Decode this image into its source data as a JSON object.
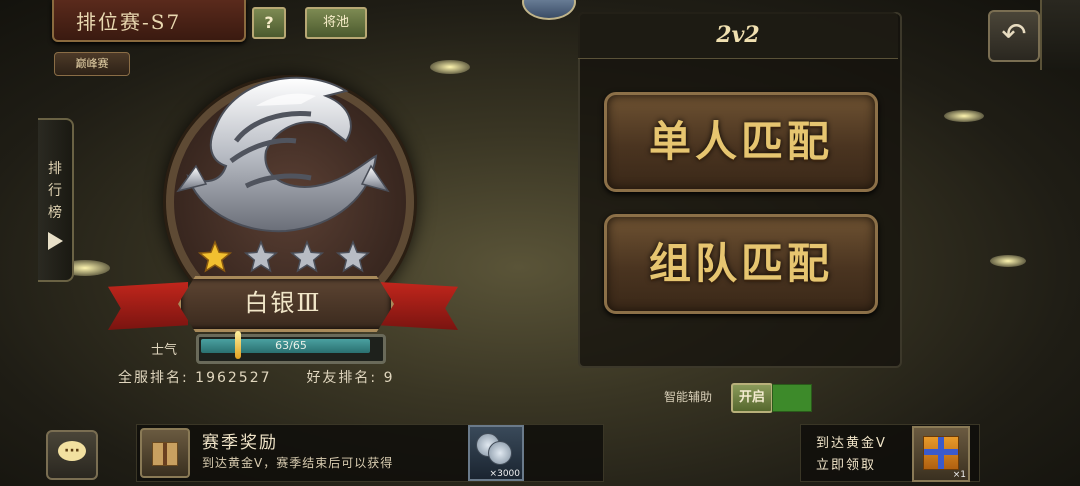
{
  "header": {
    "season_title": "排位赛-S7",
    "help_label": "?",
    "pool_label": "将池",
    "peak_label": "巅峰赛"
  },
  "sidebar": {
    "leaderboard_label": "排\n行\n榜"
  },
  "emblem": {
    "tier": "白银Ⅲ",
    "stars_filled": 1,
    "stars_total": 4,
    "morale_label": "士气",
    "morale_current": 63,
    "morale_max": 65,
    "morale_text": "63/65",
    "server_rank_label": "全服排名:",
    "server_rank": "1962527",
    "friend_rank_label": "好友排名:",
    "friend_rank": "9"
  },
  "panel": {
    "mode": "2v2",
    "solo_label": "单人匹配",
    "team_label": "组队匹配"
  },
  "assist": {
    "label": "智能辅助",
    "toggle_label": "开启"
  },
  "reward": {
    "title": "赛季奖励",
    "subtitle": "到达黄金V，赛季结束后可以获得",
    "coin_count": "×3000"
  },
  "gold_reward": {
    "line1": "到达黄金V",
    "line2": "立即领取",
    "count": "×1"
  },
  "colors": {
    "accent_gold": "#e6c570",
    "bar_fill": "#4aa0a0",
    "toggle_on": "#3d8a2a",
    "banner_red": "#c1261c"
  }
}
